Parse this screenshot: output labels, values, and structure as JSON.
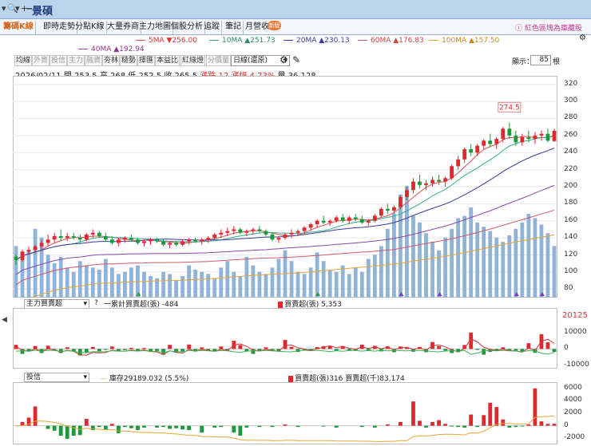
{
  "window": {
    "stock_name": "景碩",
    "title_icons": [
      "▾",
      "🔍",
      "▾",
      "+",
      "‒"
    ]
  },
  "tabs": [
    {
      "label": "籌碼K線",
      "active": true
    },
    {
      "label": "即時走勢"
    },
    {
      "label": "分點K線"
    },
    {
      "label": "大量券商"
    },
    {
      "label": "主力地圖"
    },
    {
      "label": "個股分析"
    },
    {
      "label": "追蹤"
    },
    {
      "label": "筆記"
    },
    {
      "label": "月營收"
    }
  ],
  "badge": "新版",
  "promo": "紅色區塊為庫藏股",
  "ma": [
    {
      "label": "5MA ▼256.00",
      "color": "#e05050"
    },
    {
      "label": "10MA ▲251.73",
      "color": "#2eae8a"
    },
    {
      "label": "20MA ▲230.13",
      "color": "#3a3a9a"
    },
    {
      "label": "60MA ▲176.83",
      "color": "#cf5a6a"
    },
    {
      "label": "100MA ▲157.50",
      "color": "#e3a63a"
    },
    {
      "label": "40MA ▲192.94",
      "color": "#8a4aa8"
    }
  ],
  "toolbar": {
    "buttons": [
      "均線",
      "外資",
      "投信",
      "主力",
      "融資",
      "夯林",
      "糙勢",
      "擇匯",
      "本益比",
      "紅綠燈",
      "分價量"
    ],
    "dim": [
      1,
      2,
      3,
      4,
      10
    ],
    "period": "日線(還原)",
    "display_label": "顯示：",
    "display_count": "85",
    "display_unit": "根"
  },
  "info": {
    "date": "2026/02/11",
    "open": "開 253.5",
    "high": "高 268",
    "low": "低 252.5",
    "close": "收 265.5",
    "change": "漲跌 12",
    "pct": "漲幅 4.73%",
    "volume": "量 36,128"
  },
  "chart_data": {
    "type": "candlestick",
    "x_count": 85,
    "ylim": [
      70,
      330
    ],
    "yticks": [
      80,
      100,
      120,
      140,
      160,
      180,
      200,
      220,
      240,
      260,
      280,
      300,
      320
    ],
    "annotation": "274.5",
    "colors": {
      "up": "#e0282e",
      "down": "#1a9a3a",
      "volume": "#8fb3d9"
    },
    "candles": [
      [
        118,
        120,
        108,
        114
      ],
      [
        114,
        126,
        112,
        124
      ],
      [
        124,
        130,
        120,
        126
      ],
      [
        126,
        132,
        122,
        130
      ],
      [
        130,
        138,
        126,
        134
      ],
      [
        134,
        144,
        130,
        138
      ],
      [
        138,
        146,
        134,
        142
      ],
      [
        142,
        150,
        136,
        140
      ],
      [
        140,
        146,
        136,
        142
      ],
      [
        142,
        146,
        138,
        140
      ],
      [
        140,
        144,
        134,
        138
      ],
      [
        138,
        146,
        136,
        144
      ],
      [
        144,
        150,
        140,
        146
      ],
      [
        146,
        148,
        140,
        142
      ],
      [
        142,
        146,
        136,
        138
      ],
      [
        138,
        142,
        132,
        134
      ],
      [
        134,
        140,
        130,
        138
      ],
      [
        138,
        142,
        134,
        140
      ],
      [
        140,
        144,
        136,
        138
      ],
      [
        138,
        140,
        132,
        134
      ],
      [
        134,
        138,
        130,
        136
      ],
      [
        136,
        140,
        132,
        138
      ],
      [
        138,
        140,
        134,
        136
      ],
      [
        136,
        138,
        130,
        132
      ],
      [
        132,
        136,
        128,
        134
      ],
      [
        134,
        136,
        130,
        132
      ],
      [
        132,
        138,
        130,
        136
      ],
      [
        136,
        140,
        132,
        138
      ],
      [
        138,
        140,
        134,
        136
      ],
      [
        136,
        140,
        132,
        138
      ],
      [
        138,
        142,
        134,
        140
      ],
      [
        140,
        146,
        138,
        144
      ],
      [
        144,
        150,
        140,
        146
      ],
      [
        146,
        152,
        142,
        148
      ],
      [
        148,
        154,
        144,
        150
      ],
      [
        150,
        152,
        144,
        146
      ],
      [
        146,
        150,
        142,
        148
      ],
      [
        148,
        152,
        144,
        150
      ],
      [
        150,
        154,
        146,
        148
      ],
      [
        148,
        150,
        142,
        144
      ],
      [
        144,
        146,
        136,
        138
      ],
      [
        138,
        142,
        134,
        140
      ],
      [
        140,
        146,
        138,
        144
      ],
      [
        144,
        150,
        140,
        146
      ],
      [
        146,
        150,
        142,
        148
      ],
      [
        148,
        154,
        144,
        152
      ],
      [
        152,
        158,
        148,
        156
      ],
      [
        156,
        162,
        152,
        160
      ],
      [
        160,
        166,
        156,
        158
      ],
      [
        158,
        162,
        154,
        160
      ],
      [
        160,
        166,
        158,
        164
      ],
      [
        164,
        168,
        158,
        160
      ],
      [
        160,
        166,
        156,
        164
      ],
      [
        164,
        168,
        160,
        162
      ],
      [
        162,
        166,
        156,
        158
      ],
      [
        158,
        162,
        154,
        160
      ],
      [
        160,
        168,
        158,
        166
      ],
      [
        166,
        176,
        164,
        174
      ],
      [
        174,
        180,
        168,
        172
      ],
      [
        172,
        178,
        168,
        176
      ],
      [
        176,
        190,
        174,
        188
      ],
      [
        188,
        200,
        184,
        196
      ],
      [
        196,
        210,
        192,
        206
      ],
      [
        206,
        214,
        198,
        202
      ],
      [
        202,
        208,
        196,
        204
      ],
      [
        204,
        212,
        200,
        208
      ],
      [
        208,
        214,
        202,
        206
      ],
      [
        206,
        212,
        200,
        210
      ],
      [
        210,
        226,
        208,
        224
      ],
      [
        224,
        236,
        220,
        232
      ],
      [
        232,
        246,
        228,
        244
      ],
      [
        244,
        250,
        236,
        240
      ],
      [
        240,
        250,
        236,
        248
      ],
      [
        248,
        256,
        244,
        254
      ],
      [
        254,
        262,
        246,
        250
      ],
      [
        250,
        258,
        244,
        256
      ],
      [
        256,
        270,
        252,
        268
      ],
      [
        268,
        275,
        256,
        260
      ],
      [
        260,
        266,
        248,
        252
      ],
      [
        252,
        262,
        248,
        258
      ],
      [
        258,
        266,
        252,
        256
      ],
      [
        256,
        264,
        250,
        260
      ],
      [
        260,
        266,
        254,
        262
      ],
      [
        262,
        268,
        252,
        254
      ],
      [
        253.5,
        268,
        252.5,
        265.5
      ]
    ],
    "volume": [
      120,
      90,
      110,
      160,
      140,
      100,
      80,
      95,
      70,
      60,
      85,
      75,
      70,
      65,
      90,
      70,
      55,
      60,
      70,
      75,
      60,
      50,
      45,
      60,
      55,
      40,
      50,
      75,
      65,
      60,
      55,
      45,
      70,
      85,
      60,
      50,
      95,
      75,
      60,
      55,
      70,
      90,
      110,
      85,
      60,
      55,
      70,
      105,
      85,
      65,
      60,
      75,
      55,
      70,
      60,
      90,
      100,
      120,
      160,
      195,
      240,
      260,
      190,
      175,
      150,
      130,
      110,
      140,
      160,
      185,
      190,
      210,
      175,
      165,
      155,
      140,
      130,
      145,
      160,
      175,
      195,
      185,
      170,
      150,
      120
    ],
    "pane2": {
      "label": "主力買賣超",
      "ylim": [
        -12000,
        25000
      ],
      "yticks": [
        20125,
        10000,
        0,
        -10000
      ],
      "info_cum": "一累計買賣超(張) -484",
      "info_bs": "買賣超(張) 5,353"
    },
    "pane3": {
      "label": "投信",
      "ylim": [
        -3000,
        7000
      ],
      "yticks": [
        6000,
        4000,
        2000,
        0,
        -2000
      ],
      "info_inv": "庫存29189.032 (5.5%)",
      "info_bs": "買賣超(張)316 買賣超(千)83,174"
    }
  }
}
